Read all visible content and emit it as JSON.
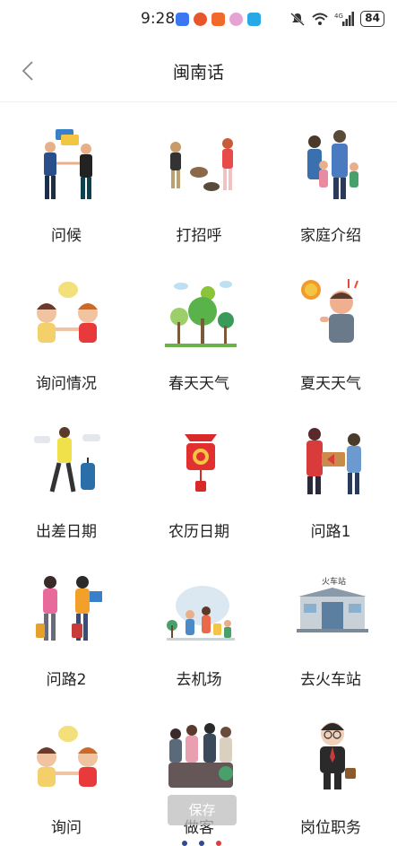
{
  "status_bar": {
    "time": "9:28",
    "app_icons": [
      "calendar-icon",
      "game-icon",
      "video-icon",
      "flower-icon",
      "search-app-icon"
    ],
    "app_colors": [
      "#3a78f2",
      "#e8572c",
      "#f06a2c",
      "#e6a2d2",
      "#27a9e5"
    ],
    "battery": "84",
    "network": "4G"
  },
  "header": {
    "title": "闽南话",
    "back_icon": "chevron-left-icon"
  },
  "topics": [
    {
      "label": "问候",
      "icon": "handshake-icon"
    },
    {
      "label": "打招呼",
      "icon": "greeting-dog-walk-icon"
    },
    {
      "label": "家庭介绍",
      "icon": "family-icon"
    },
    {
      "label": "询问情况",
      "icon": "children-chat-icon"
    },
    {
      "label": "春天天气",
      "icon": "spring-trees-icon"
    },
    {
      "label": "夏天天气",
      "icon": "hot-sun-icon"
    },
    {
      "label": "出差日期",
      "icon": "traveler-suitcase-icon"
    },
    {
      "label": "农历日期",
      "icon": "chinese-knot-icon"
    },
    {
      "label": "问路1",
      "icon": "direction-sign-icon"
    },
    {
      "label": "问路2",
      "icon": "tourists-map-icon"
    },
    {
      "label": "去机场",
      "icon": "airport-icon"
    },
    {
      "label": "去火车站",
      "icon": "train-station-icon"
    },
    {
      "label": "询问",
      "icon": "children-chat-icon"
    },
    {
      "label": "做客",
      "icon": "visiting-guests-icon"
    },
    {
      "label": "岗位职务",
      "icon": "businessman-icon"
    }
  ],
  "overlay": {
    "save_label": "保存"
  },
  "pager": {
    "dot_colors": [
      "#2f4a9a",
      "#2f4a9a",
      "#e23b3b"
    ]
  },
  "train_station_sign": "火车站"
}
